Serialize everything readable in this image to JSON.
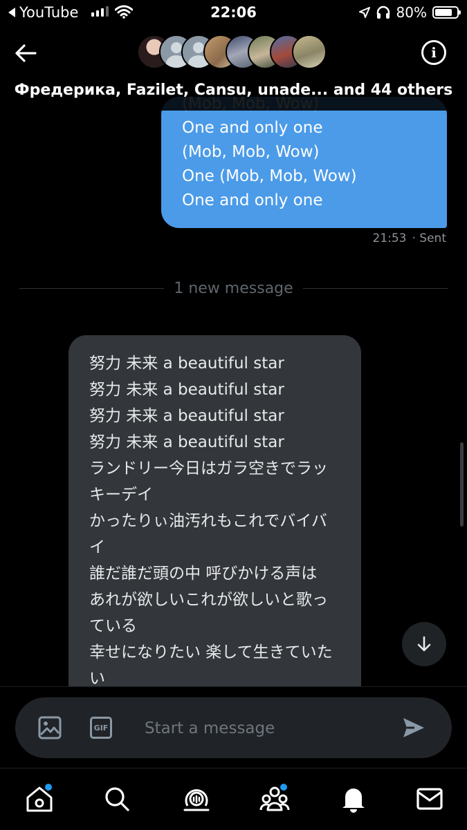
{
  "status_bar": {
    "back_app": "YouTube",
    "time": "22:06",
    "battery": "80%",
    "battery_level": 0.8
  },
  "header": {
    "group_names": "Фредерика, Fazilet, Cansu, unade... and 44 others",
    "avatar_count": 8
  },
  "outgoing": {
    "partial_line": "(Mob, Mob, Wow)",
    "lines": [
      "One and only one",
      "(Mob, Mob, Wow)",
      "One (Mob, Mob, Wow)",
      "One and only one"
    ],
    "time": "21:53",
    "status": "· Sent",
    "color": "#4b9be8"
  },
  "divider": {
    "label": "1 new message"
  },
  "incoming": {
    "lines": [
      "努力 未来 a beautiful star",
      "努力 未来 a beautiful star",
      "努力 未来 a beautiful star",
      "努力 未来 a beautiful star",
      "ランドリー今日はガラ空きでラッキーデイ",
      "かったりぃ油汚れもこれでバイバイ",
      "誰だ誰だ頭の中 呼びかける声は",
      "あれが欲しいこれが欲しいと歌っている",
      "幸せになりたい 楽して生きていたい"
    ]
  },
  "composer": {
    "placeholder": "Start a message",
    "image_icon": "image-icon",
    "gif_label": "GIF",
    "send_icon": "send-icon"
  },
  "tabs": [
    {
      "name": "home",
      "icon": "home-icon",
      "badge": true
    },
    {
      "name": "search",
      "icon": "search-icon",
      "badge": false
    },
    {
      "name": "spaces",
      "icon": "spaces-icon",
      "badge": false
    },
    {
      "name": "communities",
      "icon": "communities-icon",
      "badge": true
    },
    {
      "name": "notifications",
      "icon": "bell-icon",
      "badge": false
    },
    {
      "name": "messages",
      "icon": "mail-icon",
      "badge": false
    }
  ],
  "accent": "#1d9bf0"
}
